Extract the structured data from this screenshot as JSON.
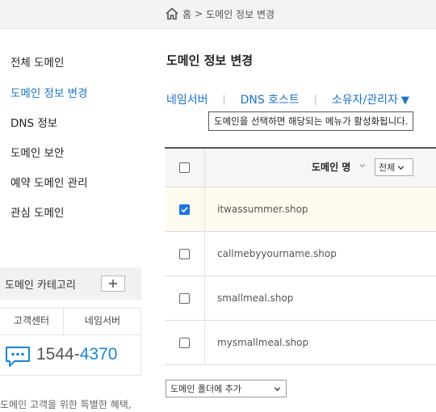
{
  "breadcrumb": {
    "home": "홈",
    "separator": ">",
    "current": "도메인 정보 변경"
  },
  "sidebar": {
    "items": [
      {
        "label": "전체 도메인",
        "active": false
      },
      {
        "label": "도메인 정보 변경",
        "active": true
      },
      {
        "label": "DNS 정보",
        "active": false
      },
      {
        "label": "도메인 보안",
        "active": false
      },
      {
        "label": "예약 도메인 관리",
        "active": false
      },
      {
        "label": "관심 도메인",
        "active": false
      }
    ],
    "category_label": "도메인 카테고리",
    "support_tabs": [
      "고객센터",
      "네임서버"
    ],
    "phone_prefix": "1544-",
    "phone_suffix": "4370",
    "promo": "도메인 고객을 위한 특별한 혜택,"
  },
  "main": {
    "title": "도메인 정보 변경",
    "tabs": [
      {
        "label": "네임서버"
      },
      {
        "label": "DNS 호스트"
      },
      {
        "label": "소유자/관리자"
      }
    ],
    "tab_separator": "|",
    "tab_caret": "▼",
    "tooltip": "도메인을 선택하면 해당되는 메뉴가 활성화됩니다.",
    "table": {
      "header_domain": "도메인 명",
      "filter_value": "전체",
      "rows": [
        {
          "domain": "itwassummer.shop",
          "checked": true
        },
        {
          "domain": "callmebyyourname.shop",
          "checked": false
        },
        {
          "domain": "smallmeal.shop",
          "checked": false
        },
        {
          "domain": "mysmallmeal.shop",
          "checked": false
        }
      ]
    },
    "folder_select": "도메인 폴더에 추가"
  },
  "colors": {
    "accent": "#1a73c8",
    "phone_highlight": "#1a86d8",
    "selected_row": "#fdfaee",
    "checkbox": "#1a73e8"
  }
}
